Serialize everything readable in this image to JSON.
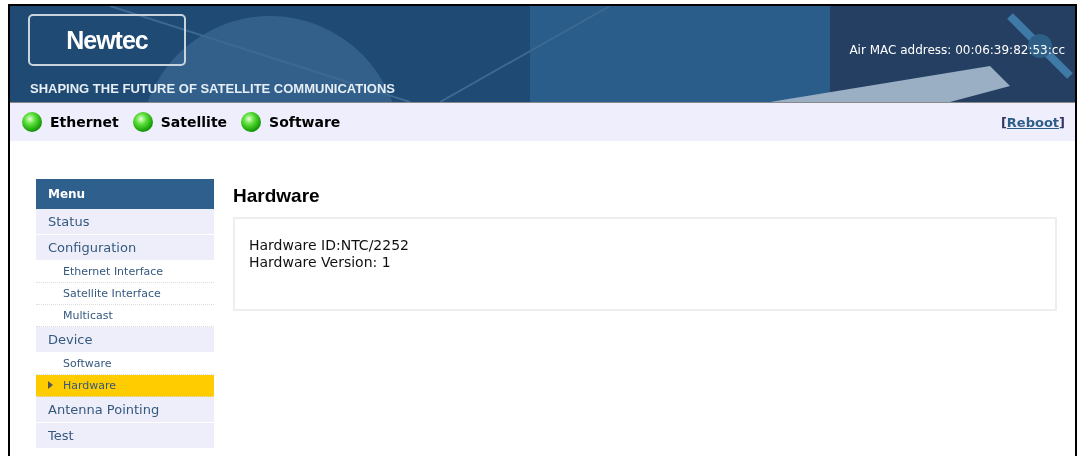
{
  "header": {
    "logo": "Newtec",
    "tagline": "SHAPING THE FUTURE OF SATELLITE COMMUNICATIONS",
    "mac": "Air MAC address: 00:06:39:82:53:cc"
  },
  "status": [
    {
      "label": "Ethernet",
      "on": true
    },
    {
      "label": "Satellite",
      "on": true
    },
    {
      "label": "Software",
      "on": true
    }
  ],
  "reboot": {
    "open": "[",
    "label": "Reboot",
    "close": "]"
  },
  "menu": {
    "title": "Menu",
    "items": [
      {
        "label": "Status",
        "kind": "item",
        "selected": false
      },
      {
        "label": "Configuration",
        "kind": "item",
        "selected": false
      },
      {
        "label": "Ethernet Interface",
        "kind": "sub",
        "selected": false
      },
      {
        "label": "Satellite Interface",
        "kind": "sub",
        "selected": false
      },
      {
        "label": "Multicast",
        "kind": "sub",
        "selected": false
      },
      {
        "label": "Device",
        "kind": "item",
        "selected": false
      },
      {
        "label": "Software",
        "kind": "sub",
        "selected": false
      },
      {
        "label": "Hardware",
        "kind": "sub",
        "selected": true
      },
      {
        "label": "Antenna Pointing",
        "kind": "item",
        "selected": false
      },
      {
        "label": "Test",
        "kind": "item",
        "selected": false
      }
    ]
  },
  "content": {
    "title": "Hardware",
    "lines": [
      "Hardware ID:NTC/2252",
      "Hardware Version: 1"
    ]
  }
}
